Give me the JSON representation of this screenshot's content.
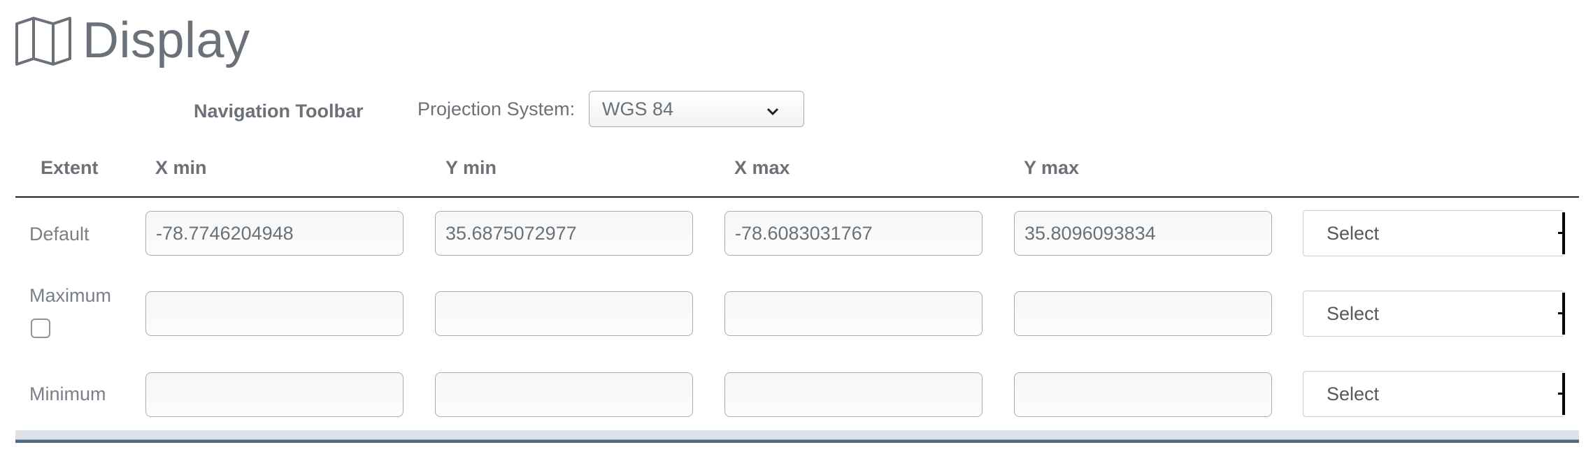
{
  "header": {
    "icon": "map-icon",
    "title": "Display"
  },
  "toolbar": {
    "navigation_label": "Navigation Toolbar",
    "projection_label": "Projection System:",
    "projection_value": "WGS 84"
  },
  "columns": {
    "extent": "Extent",
    "xmin": "X min",
    "ymin": "Y min",
    "xmax": "X max",
    "ymax": "Y max"
  },
  "rows": {
    "default": {
      "label": "Default",
      "xmin": "-78.7746204948",
      "ymin": "35.6875072977",
      "xmax": "-78.6083031767",
      "ymax": "35.8096093834",
      "select": "Select"
    },
    "maximum": {
      "label": "Maximum",
      "checked": false,
      "xmin": "",
      "ymin": "",
      "xmax": "",
      "ymax": "",
      "select": "Select"
    },
    "minimum": {
      "label": "Minimum",
      "xmin": "",
      "ymin": "",
      "xmax": "",
      "ymax": "",
      "select": "Select"
    }
  }
}
